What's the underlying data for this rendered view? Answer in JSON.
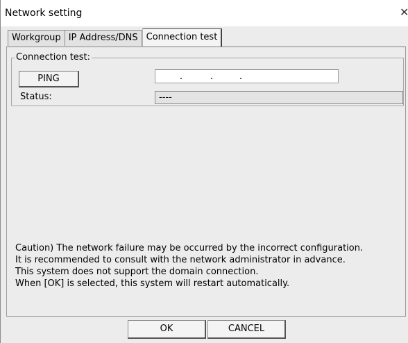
{
  "window": {
    "title": "Network setting",
    "close_glyph": "✕"
  },
  "tabs": [
    {
      "label": "Workgroup"
    },
    {
      "label": "IP Address/DNS"
    },
    {
      "label": "Connection test"
    }
  ],
  "active_tab": "Connection test",
  "group": {
    "label": "Connection test:",
    "ping_label": "PING",
    "ip_value": "",
    "status_label": "Status:",
    "status_value": "----"
  },
  "caution": [
    "Caution) The network failure may be occurred by the incorrect configuration.",
    "It is recommended to consult with the network administrator in advance.",
    "This system does not support the domain connection.",
    "When [OK] is selected, this system will restart automatically."
  ],
  "footer": {
    "ok_label": "OK",
    "cancel_label": "CANCEL"
  }
}
